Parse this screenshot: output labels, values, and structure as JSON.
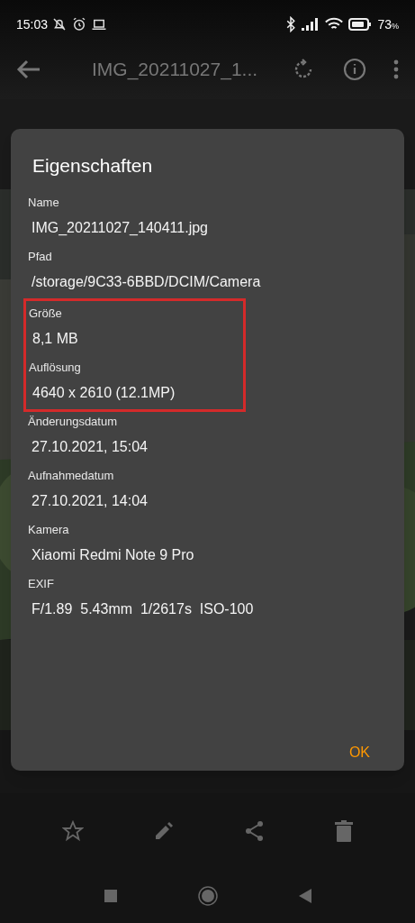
{
  "status_bar": {
    "time": "15:03",
    "battery": "73",
    "battery_unit": "%"
  },
  "app_bar": {
    "title": "IMG_20211027_1..."
  },
  "dialog": {
    "title": "Eigenschaften",
    "fields": [
      {
        "label": "Name",
        "value": "IMG_20211027_140411.jpg",
        "highlighted": false
      },
      {
        "label": "Pfad",
        "value": "/storage/9C33-6BBD/DCIM/Camera",
        "highlighted": false
      },
      {
        "label": "Größe",
        "value": "8,1 MB",
        "highlighted": true
      },
      {
        "label": "Auflösung",
        "value": "4640 x 2610 (12.1MP)",
        "highlighted": true
      },
      {
        "label": "Änderungsdatum",
        "value": "27.10.2021, 15:04",
        "highlighted": false
      },
      {
        "label": "Aufnahmedatum",
        "value": "27.10.2021, 14:04",
        "highlighted": false
      },
      {
        "label": "Kamera",
        "value": "Xiaomi Redmi Note 9 Pro",
        "highlighted": false
      },
      {
        "label": "EXIF",
        "value": "F/1.89  5.43mm  1/2617s  ISO-100",
        "highlighted": false
      }
    ],
    "button": "OK"
  }
}
